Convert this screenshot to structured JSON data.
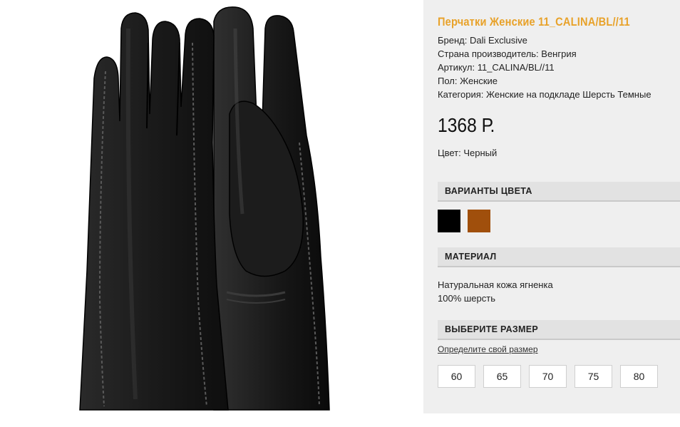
{
  "product": {
    "title": "Перчатки Женские 11_CALINA/BL//11",
    "brand": "Бренд: Dali Exclusive",
    "country": "Страна производитель: Венгрия",
    "article": "Артикул: 11_CALINA/BL//11",
    "gender": "Пол: Женские",
    "category": "Категория: Женские на подкладе Шерсть Темные",
    "price": "1368 Р.",
    "color": "Цвет: Черный"
  },
  "color_variants": {
    "heading": "ВАРИАНТЫ ЦВЕТА",
    "swatches": [
      {
        "name": "black",
        "color": "#000000"
      },
      {
        "name": "brown",
        "color": "#a04f0c"
      }
    ]
  },
  "material": {
    "heading": "МАТЕРИАЛ",
    "lines": [
      "Натуральная кожа ягненка",
      "100% шерсть"
    ]
  },
  "sizes": {
    "heading": "ВЫБЕРИТЕ РАЗМЕР",
    "size_guide_link": "Определите свой размер",
    "options": [
      "60",
      "65",
      "70",
      "75",
      "80"
    ]
  },
  "colors": {
    "title": "#e8a22a",
    "panel_bg": "#efefef",
    "section_bg": "#e2e2e2"
  },
  "image": {
    "subject": "black leather gloves pair"
  }
}
